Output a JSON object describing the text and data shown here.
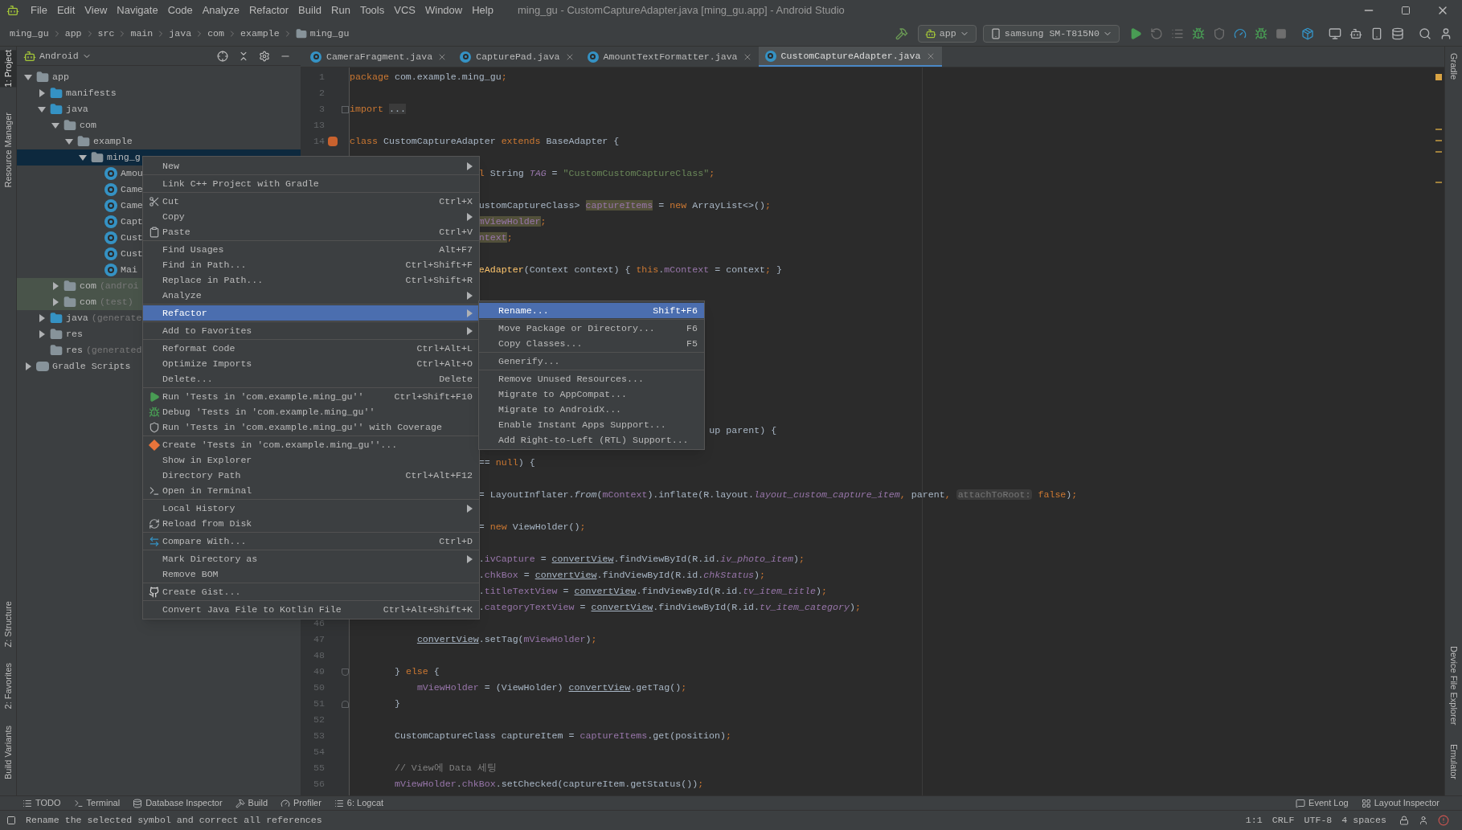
{
  "menubar": {
    "items": [
      "File",
      "Edit",
      "View",
      "Navigate",
      "Code",
      "Analyze",
      "Refactor",
      "Build",
      "Run",
      "Tools",
      "VCS",
      "Window",
      "Help"
    ],
    "title": "ming_gu - CustomCaptureAdapter.java [ming_gu.app] - Android Studio"
  },
  "toolbar": {
    "breadcrumbs": [
      "ming_gu",
      "app",
      "src",
      "main",
      "java",
      "com",
      "example",
      "ming_gu"
    ],
    "config": "app",
    "device": "samsung SM-T815N0"
  },
  "left_strip": {
    "top": [
      {
        "label": "1: Project",
        "selected": true
      },
      {
        "label": "Resource Manager",
        "selected": false
      }
    ],
    "bottom": [
      "Z: Structure",
      "2: Favorites",
      "Build Variants"
    ]
  },
  "right_strip": {
    "top": [
      "Gradle"
    ],
    "bottom": [
      "Device File Explorer",
      "Emulator"
    ]
  },
  "project_panel": {
    "view": "Android",
    "tree": [
      {
        "name": "app",
        "kind": "module",
        "expanded": true,
        "selected": false,
        "highlighted": false,
        "children": [
          {
            "name": "manifests",
            "kind": "folder",
            "expanded": false,
            "selected": false,
            "highlighted": false
          },
          {
            "name": "java",
            "kind": "folder",
            "expanded": true,
            "selected": false,
            "highlighted": false,
            "children": [
              {
                "name": "com",
                "kind": "package",
                "expanded": true,
                "selected": false,
                "highlighted": false,
                "children": [
                  {
                    "name": "example",
                    "kind": "package",
                    "expanded": true,
                    "selected": false,
                    "highlighted": false,
                    "children": [
                      {
                        "name": "ming_g",
                        "kind": "package",
                        "expanded": true,
                        "selected": true,
                        "highlighted": false,
                        "children": [
                          {
                            "name": "Amou",
                            "kind": "class",
                            "selected": false,
                            "highlighted": false
                          },
                          {
                            "name": "Came",
                            "kind": "class",
                            "selected": false,
                            "highlighted": false
                          },
                          {
                            "name": "Came",
                            "kind": "class",
                            "selected": false,
                            "highlighted": false
                          },
                          {
                            "name": "Capt",
                            "kind": "class",
                            "selected": false,
                            "highlighted": false
                          },
                          {
                            "name": "Cust",
                            "kind": "class",
                            "selected": false,
                            "highlighted": false
                          },
                          {
                            "name": "Cust",
                            "kind": "class",
                            "selected": false,
                            "highlighted": false
                          },
                          {
                            "name": "Mai",
                            "kind": "class",
                            "selected": false,
                            "highlighted": false
                          }
                        ]
                      }
                    ]
                  }
                ]
              },
              {
                "name": "com",
                "note": "(androi",
                "kind": "package",
                "expanded": false,
                "selected": false,
                "highlighted": true
              },
              {
                "name": "com",
                "note": "(test)",
                "kind": "package",
                "expanded": false,
                "selected": false,
                "highlighted": true
              }
            ]
          },
          {
            "name": "java",
            "note": "(generate",
            "kind": "generated",
            "expanded": false,
            "selected": false,
            "highlighted": false
          },
          {
            "name": "res",
            "kind": "res",
            "expanded": false,
            "selected": false,
            "highlighted": false
          },
          {
            "name": "res",
            "note": "(generated",
            "kind": "res",
            "selected": false,
            "highlighted": false
          }
        ]
      },
      {
        "name": "Gradle Scripts",
        "kind": "gradle",
        "expanded": false,
        "selected": false,
        "highlighted": false
      }
    ]
  },
  "editor": {
    "tabs": [
      {
        "label": "CameraFragment.java",
        "selected": false
      },
      {
        "label": "CapturePad.java",
        "selected": false
      },
      {
        "label": "AmountTextFormatter.java",
        "selected": false
      },
      {
        "label": "CustomCaptureAdapter.java",
        "selected": true
      }
    ],
    "rows": [
      {
        "number": "1",
        "tokens": [
          {
            "kind": "kw",
            "text": "package "
          },
          {
            "kind": "plain",
            "text": "com.example.ming_gu"
          },
          {
            "kind": "kw",
            "text": ";"
          }
        ]
      },
      {
        "number": "2"
      },
      {
        "number": "3",
        "kind": "folded",
        "tokens": [
          {
            "kind": "kw",
            "text": "import "
          },
          {
            "kind": "fold",
            "text": "..."
          }
        ]
      },
      {
        "number": "13"
      },
      {
        "number": "14",
        "kind": "class-decl",
        "tokens": [
          {
            "kind": "kw",
            "text": "class "
          },
          {
            "kind": "plain",
            "text": "CustomCaptureAdapter "
          },
          {
            "kind": "kw",
            "text": "extends "
          },
          {
            "kind": "plain",
            "text": "BaseAdapter {"
          }
        ]
      },
      {},
      {
        "tokens": [
          {
            "kind": "kw",
            "text": "                       l "
          },
          {
            "kind": "plain",
            "text": "String "
          },
          {
            "kind": "static",
            "text": "TAG"
          },
          {
            "kind": "plain",
            "text": " = "
          },
          {
            "kind": "str",
            "text": "\"CustomCustomCaptureClass\""
          },
          {
            "kind": "kw",
            "text": ";"
          }
        ]
      },
      {},
      {
        "tokens": [
          {
            "kind": "plain",
            "text": "                       ustomCaptureClass> "
          },
          {
            "kind": "hl",
            "text": "captureItems"
          },
          {
            "kind": "plain",
            "text": " = "
          },
          {
            "kind": "kw",
            "text": "new "
          },
          {
            "kind": "plain",
            "text": "ArrayList<>()"
          },
          {
            "kind": "kw",
            "text": ";"
          }
        ]
      },
      {
        "tokens": [
          {
            "kind": "hl",
            "text": "                       mViewHolder"
          },
          {
            "kind": "kw",
            "text": ";"
          }
        ]
      },
      {
        "tokens": [
          {
            "kind": "hl",
            "text": "                       ntext"
          },
          {
            "kind": "kw",
            "text": ";"
          }
        ]
      },
      {},
      {
        "tokens": [
          {
            "kind": "decl",
            "text": "                       eAdapter"
          },
          {
            "kind": "plain",
            "text": "(Context context) { "
          },
          {
            "kind": "kw",
            "text": "this"
          },
          {
            "kind": "plain",
            "text": "."
          },
          {
            "kind": "field",
            "text": "mContext"
          },
          {
            "kind": "plain",
            "text": " = context"
          },
          {
            "kind": "kw",
            "text": ";"
          },
          {
            "kind": "plain",
            "text": " }"
          }
        ]
      },
      {},
      {},
      {},
      {},
      {},
      {},
      {},
      {},
      {},
      {
        "tokens": [
          {
            "kind": "plain",
            "text": "                                                                up parent) {"
          }
        ]
      },
      {},
      {
        "tokens": [
          {
            "kind": "plain",
            "text": "                       == "
          },
          {
            "kind": "kw",
            "text": "null"
          },
          {
            "kind": "plain",
            "text": ") {"
          }
        ]
      },
      {},
      {
        "tokens": [
          {
            "kind": "plain",
            "text": "                       = LayoutInflater."
          },
          {
            "kind": "italic",
            "text": "from"
          },
          {
            "kind": "plain",
            "text": "("
          },
          {
            "kind": "field",
            "text": "mContext"
          },
          {
            "kind": "plain",
            "text": ").inflate(R.layout."
          },
          {
            "kind": "static",
            "text": "layout_custom_capture_item"
          },
          {
            "kind": "kw",
            "text": ", "
          },
          {
            "kind": "plain",
            "text": "parent"
          },
          {
            "kind": "kw",
            "text": ", "
          },
          {
            "kind": "hint",
            "text": "attachToRoot:"
          },
          {
            "kind": "kw",
            "text": " false"
          },
          {
            "kind": "plain",
            "text": ")"
          },
          {
            "kind": "kw",
            "text": ";"
          }
        ]
      },
      {},
      {
        "tokens": [
          {
            "kind": "plain",
            "text": "                       = "
          },
          {
            "kind": "kw",
            "text": "new "
          },
          {
            "kind": "plain",
            "text": "ViewHolder()"
          },
          {
            "kind": "kw",
            "text": ";"
          }
        ]
      },
      {},
      {
        "tokens": [
          {
            "kind": "plain",
            "text": "                       ."
          },
          {
            "kind": "field",
            "text": "ivCapture"
          },
          {
            "kind": "plain",
            "text": " = "
          },
          {
            "kind": "under",
            "text": "convertView"
          },
          {
            "kind": "plain",
            "text": ".findViewById(R.id."
          },
          {
            "kind": "static",
            "text": "iv_photo_item"
          },
          {
            "kind": "plain",
            "text": ")"
          },
          {
            "kind": "kw",
            "text": ";"
          }
        ]
      },
      {
        "tokens": [
          {
            "kind": "plain",
            "text": "                       ."
          },
          {
            "kind": "field",
            "text": "chkBox"
          },
          {
            "kind": "plain",
            "text": " = "
          },
          {
            "kind": "under",
            "text": "convertView"
          },
          {
            "kind": "plain",
            "text": ".findViewById(R.id."
          },
          {
            "kind": "static",
            "text": "chkStatus"
          },
          {
            "kind": "plain",
            "text": ")"
          },
          {
            "kind": "kw",
            "text": ";"
          }
        ]
      },
      {
        "tokens": [
          {
            "kind": "plain",
            "text": "                       ."
          },
          {
            "kind": "field",
            "text": "titleTextView"
          },
          {
            "kind": "plain",
            "text": " = "
          },
          {
            "kind": "under",
            "text": "convertView"
          },
          {
            "kind": "plain",
            "text": ".findViewById(R.id."
          },
          {
            "kind": "static",
            "text": "tv_item_title"
          },
          {
            "kind": "plain",
            "text": ")"
          },
          {
            "kind": "kw",
            "text": ";"
          }
        ]
      },
      {
        "tokens": [
          {
            "kind": "plain",
            "text": "                       ."
          },
          {
            "kind": "field",
            "text": "categoryTextView"
          },
          {
            "kind": "plain",
            "text": " = "
          },
          {
            "kind": "under",
            "text": "convertView"
          },
          {
            "kind": "plain",
            "text": ".findViewById(R.id."
          },
          {
            "kind": "static",
            "text": "tv_item_category"
          },
          {
            "kind": "plain",
            "text": ")"
          },
          {
            "kind": "kw",
            "text": ";"
          }
        ]
      },
      {
        "number": "46"
      },
      {
        "number": "47",
        "tokens": [
          {
            "kind": "under",
            "text": "            convertView"
          },
          {
            "kind": "plain",
            "text": ".setTag("
          },
          {
            "kind": "field",
            "text": "mViewHolder"
          },
          {
            "kind": "plain",
            "text": ")"
          },
          {
            "kind": "kw",
            "text": ";"
          }
        ]
      },
      {
        "number": "48"
      },
      {
        "number": "49",
        "kind": "block-start",
        "tokens": [
          {
            "kind": "plain",
            "text": "        } "
          },
          {
            "kind": "kw",
            "text": "else "
          },
          {
            "kind": "plain",
            "text": "{"
          }
        ]
      },
      {
        "number": "50",
        "tokens": [
          {
            "kind": "field",
            "text": "            mViewHolder"
          },
          {
            "kind": "plain",
            "text": " = (ViewHolder) "
          },
          {
            "kind": "under",
            "text": "convertView"
          },
          {
            "kind": "plain",
            "text": ".getTag()"
          },
          {
            "kind": "kw",
            "text": ";"
          }
        ]
      },
      {
        "number": "51",
        "kind": "block-end",
        "tokens": [
          {
            "kind": "plain",
            "text": "        }"
          }
        ]
      },
      {
        "number": "52"
      },
      {
        "number": "53",
        "tokens": [
          {
            "kind": "plain",
            "text": "        CustomCaptureClass captureItem = "
          },
          {
            "kind": "field",
            "text": "captureItems"
          },
          {
            "kind": "plain",
            "text": ".get(position)"
          },
          {
            "kind": "kw",
            "text": ";"
          }
        ]
      },
      {
        "number": "54"
      },
      {
        "number": "55",
        "tokens": [
          {
            "kind": "comment",
            "text": "        // View에 Data 세팅"
          }
        ]
      },
      {
        "number": "56",
        "tokens": [
          {
            "kind": "field",
            "text": "        mViewHolder"
          },
          {
            "kind": "plain",
            "text": "."
          },
          {
            "kind": "field",
            "text": "chkBox"
          },
          {
            "kind": "plain",
            "text": ".setChecked(captureItem.getStatus())"
          },
          {
            "kind": "kw",
            "text": ";"
          }
        ]
      }
    ]
  },
  "context_menu": {
    "items": [
      {
        "kind": "item",
        "label": "New",
        "submenu": true,
        "selected": false
      },
      {
        "kind": "separator"
      },
      {
        "kind": "item",
        "label": "Link C++ Project with Gradle",
        "selected": false
      },
      {
        "kind": "separator"
      },
      {
        "kind": "cut",
        "label": "Cut",
        "shortcut": "Ctrl+X",
        "selected": false
      },
      {
        "kind": "item",
        "label": "Copy",
        "submenu": true,
        "selected": false
      },
      {
        "kind": "paste",
        "label": "Paste",
        "shortcut": "Ctrl+V",
        "selected": false
      },
      {
        "kind": "separator"
      },
      {
        "kind": "item",
        "label": "Find Usages",
        "shortcut": "Alt+F7",
        "selected": false
      },
      {
        "kind": "item",
        "label": "Find in Path...",
        "shortcut": "Ctrl+Shift+F",
        "selected": false
      },
      {
        "kind": "item",
        "label": "Replace in Path...",
        "shortcut": "Ctrl+Shift+R",
        "selected": false
      },
      {
        "kind": "item",
        "label": "Analyze",
        "submenu": true,
        "selected": false
      },
      {
        "kind": "separator"
      },
      {
        "kind": "item",
        "label": "Refactor",
        "submenu": true,
        "selected": true
      },
      {
        "kind": "separator"
      },
      {
        "kind": "item",
        "label": "Add to Favorites",
        "submenu": true,
        "selected": false
      },
      {
        "kind": "separator"
      },
      {
        "kind": "item",
        "label": "Reformat Code",
        "shortcut": "Ctrl+Alt+L",
        "selected": false
      },
      {
        "kind": "item",
        "label": "Optimize Imports",
        "shortcut": "Ctrl+Alt+O",
        "selected": false
      },
      {
        "kind": "item",
        "label": "Delete...",
        "shortcut": "Delete",
        "selected": false
      },
      {
        "kind": "separator"
      },
      {
        "kind": "run",
        "label": "Run 'Tests in 'com.example.ming_gu''",
        "shortcut": "Ctrl+Shift+F10",
        "selected": false
      },
      {
        "kind": "debug",
        "label": "Debug 'Tests in 'com.example.ming_gu''",
        "selected": false
      },
      {
        "kind": "coverage",
        "label": "Run 'Tests in 'com.example.ming_gu'' with Coverage",
        "selected": false
      },
      {
        "kind": "separator"
      },
      {
        "kind": "create",
        "label": "Create 'Tests in 'com.example.ming_gu''...",
        "selected": false
      },
      {
        "kind": "item",
        "label": "Show in Explorer",
        "selected": false
      },
      {
        "kind": "item",
        "label": "Directory Path",
        "shortcut": "Ctrl+Alt+F12",
        "selected": false
      },
      {
        "kind": "terminal",
        "label": "Open in Terminal",
        "selected": false
      },
      {
        "kind": "separator"
      },
      {
        "kind": "item",
        "label": "Local History",
        "submenu": true,
        "selected": false
      },
      {
        "kind": "reload",
        "label": "Reload from Disk",
        "selected": false
      },
      {
        "kind": "separator"
      },
      {
        "kind": "compare",
        "label": "Compare With...",
        "shortcut": "Ctrl+D",
        "selected": false
      },
      {
        "kind": "separator"
      },
      {
        "kind": "item",
        "label": "Mark Directory as",
        "submenu": true,
        "selected": false
      },
      {
        "kind": "item",
        "label": "Remove BOM",
        "selected": false
      },
      {
        "kind": "separator"
      },
      {
        "kind": "gist",
        "label": "Create Gist...",
        "selected": false
      },
      {
        "kind": "separator"
      },
      {
        "kind": "item",
        "label": "Convert Java File to Kotlin File",
        "shortcut": "Ctrl+Alt+Shift+K",
        "selected": false
      }
    ]
  },
  "refactor_submenu": {
    "items": [
      {
        "kind": "item",
        "label": "Rename...",
        "shortcut": "Shift+F6",
        "selected": true
      },
      {
        "kind": "separator"
      },
      {
        "kind": "item",
        "label": "Move Package or Directory...",
        "shortcut": "F6",
        "selected": false
      },
      {
        "kind": "item",
        "label": "Copy Classes...",
        "shortcut": "F5",
        "selected": false
      },
      {
        "kind": "separator"
      },
      {
        "kind": "item",
        "label": "Generify...",
        "selected": false
      },
      {
        "kind": "separator"
      },
      {
        "kind": "item",
        "label": "Remove Unused Resources...",
        "selected": false
      },
      {
        "kind": "item",
        "label": "Migrate to AppCompat...",
        "selected": false
      },
      {
        "kind": "item",
        "label": "Migrate to AndroidX...",
        "selected": false
      },
      {
        "kind": "item",
        "label": "Enable Instant Apps Support...",
        "selected": false
      },
      {
        "kind": "item",
        "label": "Add Right-to-Left (RTL) Support...",
        "selected": false
      }
    ]
  },
  "tool_windows": {
    "left": [
      {
        "label": "TODO",
        "kind": "todo"
      },
      {
        "label": "Terminal",
        "kind": "terminal"
      },
      {
        "label": "Database Inspector",
        "kind": "database"
      },
      {
        "label": "Build",
        "kind": "build"
      },
      {
        "label": "Profiler",
        "kind": "profiler"
      },
      {
        "label": "6: Logcat",
        "kind": "logcat"
      }
    ],
    "right": [
      {
        "label": "Event Log",
        "kind": "log"
      },
      {
        "label": "Layout Inspector",
        "kind": "inspector"
      }
    ]
  },
  "status_bar": {
    "message": "Rename the selected symbol and correct all references",
    "items": [
      "1:1",
      "CRLF",
      "UTF-8",
      "4 spaces"
    ]
  }
}
